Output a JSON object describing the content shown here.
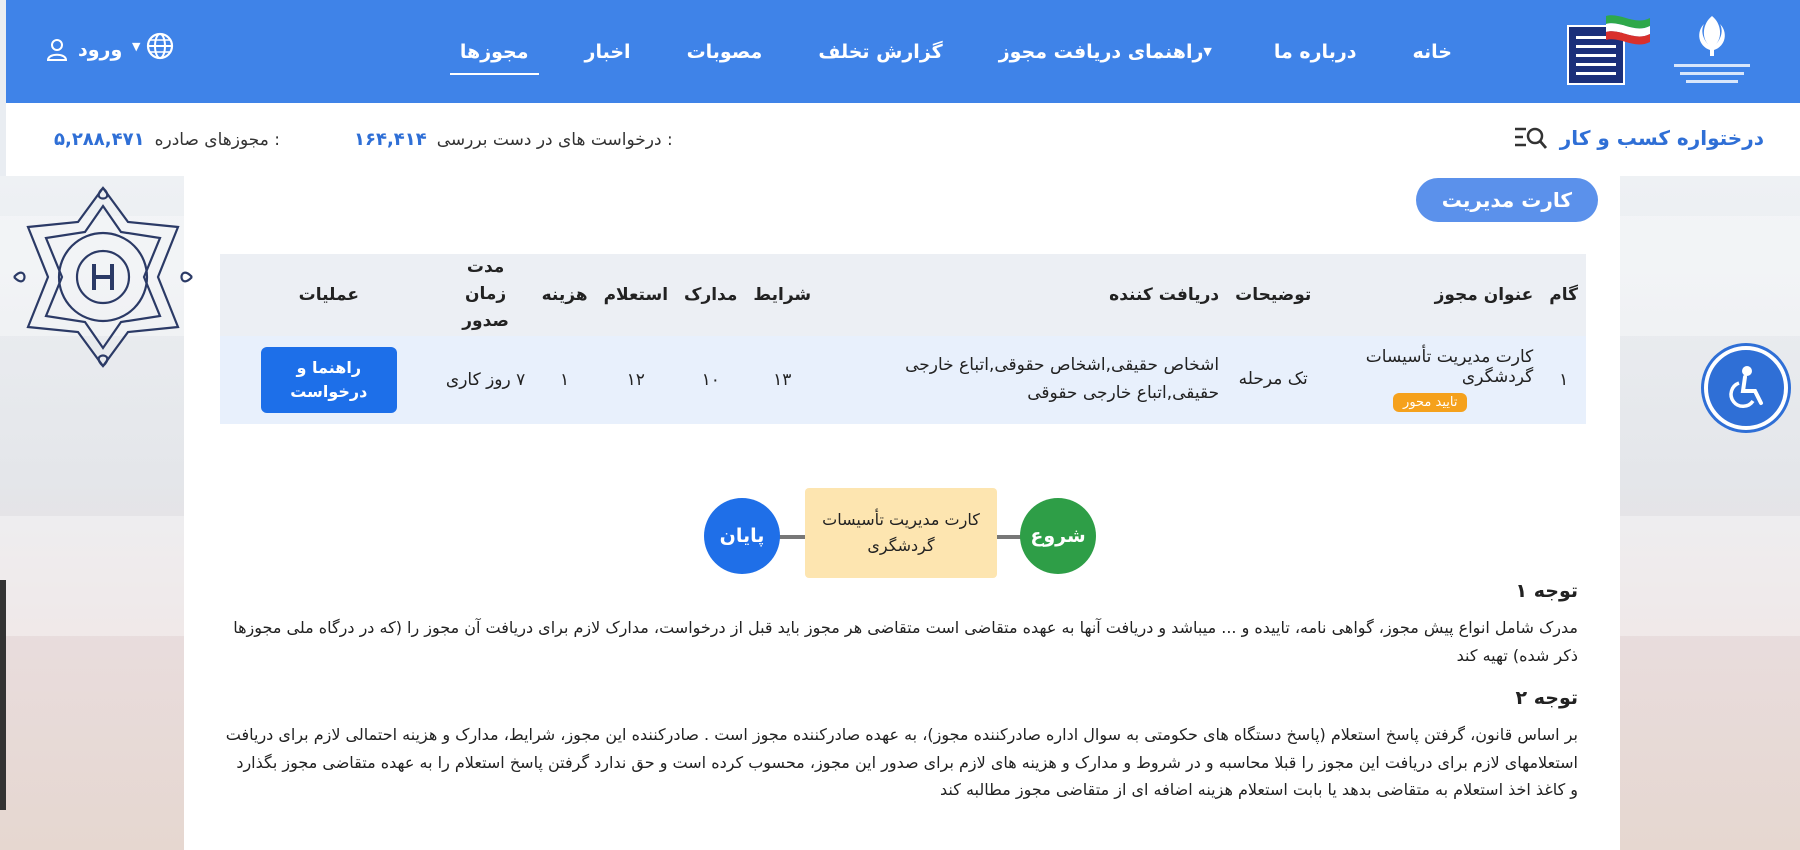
{
  "header": {
    "nav": [
      {
        "label": "خانه",
        "active": false
      },
      {
        "label": "درباره ما",
        "active": false
      },
      {
        "label": "راهنمای دریافت مجوز",
        "active": false,
        "dropdown": true
      },
      {
        "label": "گزارش تخلف",
        "active": false
      },
      {
        "label": "مصوبات",
        "active": false
      },
      {
        "label": "اخبار",
        "active": false
      },
      {
        "label": "مجوزها",
        "active": true
      }
    ],
    "login_label": "ورود"
  },
  "stats": {
    "portal_title": "درختواره کسب و کار",
    "review_label": "درخواست های در دست بررسی :",
    "review_value": "۱۶۴,۴۱۴",
    "issued_label": "مجوزهای صادره :",
    "issued_value": "۵,۲۸۸,۴۷۱"
  },
  "card": {
    "title": "کارت مدیریت",
    "table": {
      "headers": {
        "step": "گام",
        "permit_title": "عنوان مجوز",
        "description": "توضیحات",
        "recipient": "دریافت کننده",
        "conditions": "شرایط",
        "documents": "مدارک",
        "inquiry": "استعلام",
        "cost": "هزینه",
        "duration": "مدت زمان صدور",
        "operations": "عملیات"
      },
      "rows": [
        {
          "step": "۱",
          "permit_title": "کارت مدیریت تأسیسات گردشگری",
          "badge": "تایید محور",
          "description": "تک مرحله",
          "recipient": "اشخاص حقیقی,اشخاص حقوقی,اتباع خارجی حقیقی,اتباع خارجی حقوقی",
          "conditions": "۱۳",
          "documents": "۱۰",
          "inquiry": "۱۲",
          "cost": "۱",
          "duration": "۷ روز کاری",
          "action_label": "راهنما و درخواست"
        }
      ]
    },
    "flow": {
      "start_label": "شروع",
      "step_label": "کارت مدیریت تأسیسات گردشگری",
      "end_label": "پایان"
    },
    "notes": [
      {
        "title": "توجه ۱",
        "body": "مدرک شامل انواع پیش مجوز، گواهی نامه، تاییده و ... میباشد و دریافت آنها به عهده متقاضی است متقاضی هر مجوز باید قبل از درخواست، مدارک لازم برای دریافت آن مجوز را (که در درگاه ملی مجوزها ذکر شده) تهیه کند"
      },
      {
        "title": "توجه ۲",
        "body": "بر اساس قانون، گرفتن پاسخ استعلام (پاسخ دستگاه های حکومتی به سوال اداره صادرکننده مجوز)، به عهده صادرکننده مجوز است . صادرکننده این مجوز، شرایط، مدارک و هزینه احتمالی لازم برای دریافت استعلامهای لازم برای دریافت این مجوز را قبلا محاسبه و در شروط و مدارک و هزینه های لازم برای صدور این مجوز، محسوب کرده است و حق ندارد گرفتن پاسخ استعلام را به عهده متقاضی مجوز بگذارد و کاغذ اخذ استعلام به متقاضی بدهد یا بابت استعلام هزینه اضافه ای از متقاضی مجوز مطالبه کند"
      }
    ]
  },
  "colors": {
    "navbar": "#3f83e8",
    "accent_blue": "#2f6fd6",
    "badge_orange": "#f5a11c",
    "start_green": "#2e9e47",
    "step_box": "#fde5b0"
  },
  "icons": [
    "iran-emblem-icon",
    "ministry-logo-icon",
    "globe-icon",
    "user-icon",
    "search-list-icon",
    "decorative-seal-icon",
    "accessibility-icon"
  ]
}
